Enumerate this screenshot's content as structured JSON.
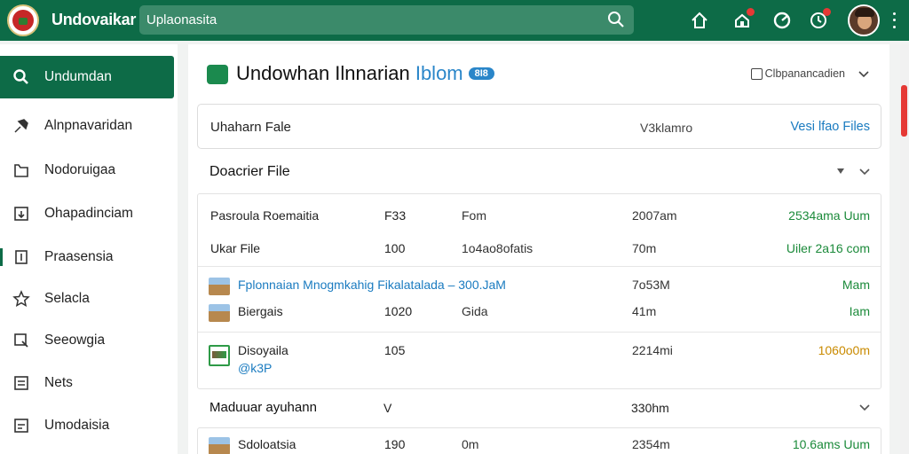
{
  "app": {
    "brand": "Undovaikar"
  },
  "search": {
    "value": "Uplaonasita",
    "placeholder": ""
  },
  "topbar": {
    "icons": [
      "home-icon",
      "notifications-icon",
      "refresh-icon",
      "clock-icon"
    ]
  },
  "sidebar": {
    "items": [
      {
        "label": "Undumdan",
        "icon": "search-icon",
        "active": true
      },
      {
        "label": "Alnpnavaridan",
        "icon": "pin-icon"
      },
      {
        "label": "Nodoruigaa",
        "icon": "folder-icon"
      },
      {
        "label": "Ohapadinciam",
        "icon": "download-icon"
      },
      {
        "label": "Praasensia",
        "icon": "document-icon"
      },
      {
        "label": "Selacla",
        "icon": "star-icon"
      },
      {
        "label": "Seeowgia",
        "icon": "share-icon"
      },
      {
        "label": "Nets",
        "icon": "list-icon"
      },
      {
        "label": "Umodaisia",
        "icon": "inbox-icon"
      }
    ]
  },
  "main": {
    "title": "Undowhan Ilnnarian",
    "title_accent": "Iblom",
    "badge": "8I8",
    "menu_label": "Clbpanancadien",
    "header": {
      "label": "Uhaharn Fale",
      "mid": "V3klamro",
      "link": "Vesi lfao Files"
    },
    "section1": {
      "label": "Doacrier File"
    },
    "section2": {
      "label": "Maduuar ayuhann",
      "mid": "V",
      "size": "330hm"
    },
    "rows": {
      "r1": {
        "name": "Pasroula Roemaitia",
        "num": "F33",
        "type": "Fom",
        "size": "2007am",
        "status": "2534ama Uum"
      },
      "r2": {
        "name": "Ukar File",
        "num": "100",
        "type": "1o4ao8ofatis",
        "size": "70m",
        "status": "Uiler 2a16 com"
      },
      "r3": {
        "name": "Fplonnaian Mnogmkahig Fikalatalada – 300.JaM",
        "size": "7o53M",
        "status": "Mam"
      },
      "r4": {
        "name": "Biergais",
        "num": "1020",
        "type": "Gida",
        "size": "41m",
        "status": "Iam"
      },
      "r5": {
        "name": "Disoyaila",
        "sub": "@k3P",
        "num": "105",
        "size": "2214mi",
        "status": "1060o0m"
      },
      "r6": {
        "name": "Sdoloatsia",
        "num": "190",
        "type": "0m",
        "size": "2354m",
        "status": "10.6ams Uum"
      }
    }
  },
  "colors": {
    "brand": "#0d6b47",
    "link": "#1a7bc0",
    "ok": "#1b8a3a",
    "warn": "#c98a00"
  }
}
